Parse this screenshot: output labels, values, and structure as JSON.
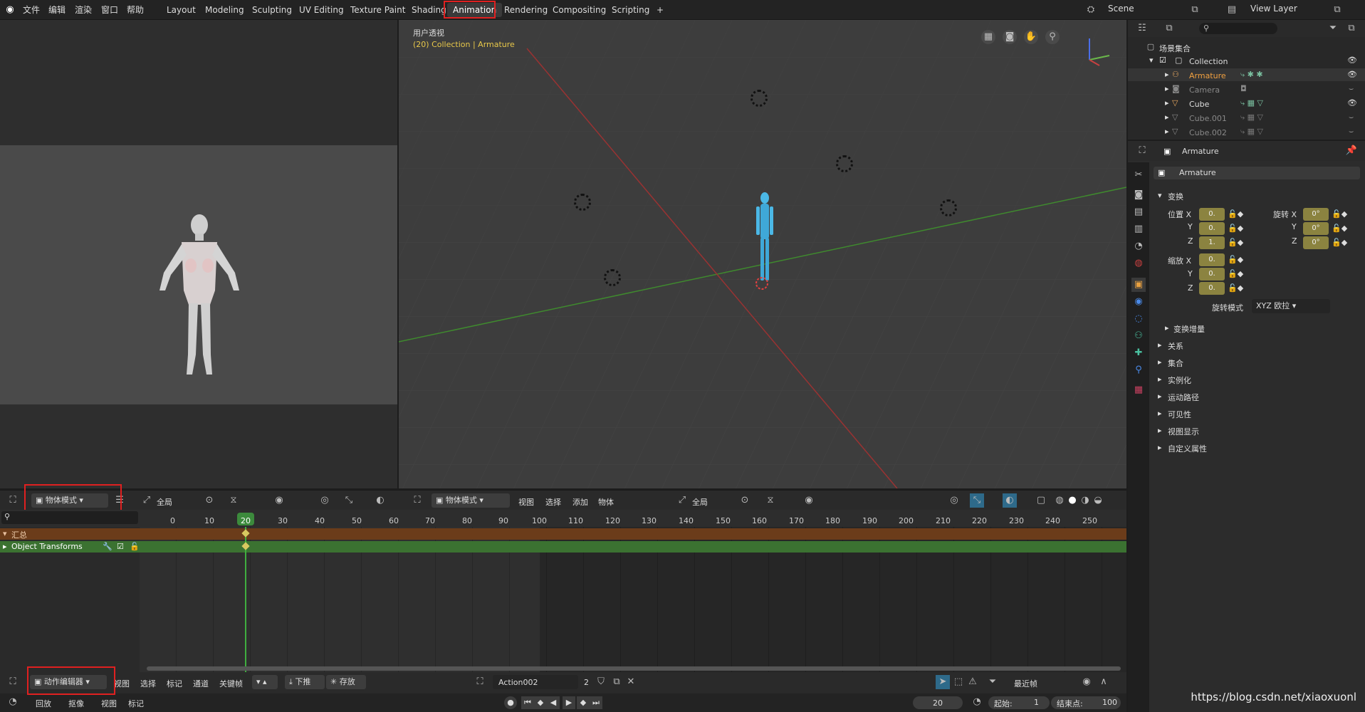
{
  "topbar": {
    "menus": [
      "文件",
      "编辑",
      "渲染",
      "窗口",
      "帮助"
    ],
    "workspaces": [
      "Layout",
      "Modeling",
      "Sculpting",
      "UV Editing",
      "Texture Paint",
      "Shading",
      "Animation",
      "Rendering",
      "Compositing",
      "Scripting"
    ],
    "active_workspace": "Animation",
    "add_label": "+",
    "scene_label": "Scene",
    "view_layer_label": "View Layer"
  },
  "viewport": {
    "view_label": "用户透视",
    "info_label": "(20) Collection | Armature",
    "header": {
      "mode": "物体模式",
      "menus": [
        "视图",
        "选择",
        "添加",
        "物体"
      ],
      "transform_orientation": "全局"
    }
  },
  "left_viewport": {
    "mode": "物体模式",
    "transform_orientation": "全局"
  },
  "outliner": {
    "title": "场景集合",
    "search_placeholder": "",
    "items": [
      {
        "name": "Collection"
      },
      {
        "name": "Armature"
      },
      {
        "name": "Camera"
      },
      {
        "name": "Cube"
      },
      {
        "name": "Cube.001"
      },
      {
        "name": "Cube.002"
      }
    ]
  },
  "properties": {
    "object_name": "Armature",
    "object_field": "Armature",
    "section_transform": "变换",
    "location_label": "位置 X",
    "rotation_label": "旋转 X",
    "scale_label": "缩放 X",
    "y_label": "Y",
    "z_label": "Z",
    "loc": [
      "0.",
      "0.",
      "1."
    ],
    "rot": [
      "0°",
      "0°",
      "0°"
    ],
    "scale": [
      "0.",
      "0.",
      "0."
    ],
    "rotation_mode_label": "旋转模式",
    "rotation_mode_value": "XYZ 欧拉",
    "delta_transform": "变换增量",
    "panels": [
      "关系",
      "集合",
      "实例化",
      "运动路径",
      "可见性",
      "视图显示",
      "自定义属性"
    ]
  },
  "timeline": {
    "ruler": [
      "0",
      "10",
      "20",
      "30",
      "40",
      "50",
      "60",
      "70",
      "80",
      "90",
      "100",
      "110",
      "120",
      "130",
      "140",
      "150",
      "160",
      "170",
      "180",
      "190",
      "200",
      "210",
      "220",
      "230",
      "240",
      "250"
    ],
    "current_frame": "20",
    "summary_label": "汇总",
    "channel_label": "Object Transforms",
    "header": {
      "editor": "动作编辑器",
      "menus": [
        "视图",
        "选择",
        "标记",
        "通道",
        "关键帧"
      ],
      "push_down": "下推",
      "stash": "存放",
      "action_name": "Action002",
      "users": "2",
      "snap_label": "最近帧"
    },
    "playback": {
      "menus": [
        "回放",
        "抠像",
        "视图",
        "标记"
      ],
      "frame": "20",
      "start_label": "起始:",
      "start": "1",
      "end_label": "结束点:",
      "end": "100"
    }
  },
  "watermark": "https://blog.csdn.net/xiaoxuonl"
}
